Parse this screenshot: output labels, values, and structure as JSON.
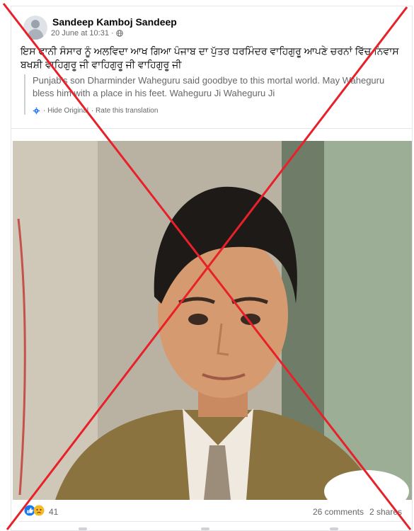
{
  "post": {
    "author": "Sandeep Kamboj Sandeep",
    "timestamp": "20 June at 10:31 ·",
    "privacy_icon": "globe-icon",
    "text": "ਇਸ ਫਾਨੀ ਸੰਸਾਰ ਨੂੰ ਅਲਵਿਦਾ ਆਖ ਗਿਆ ਪੰਜਾਬ ਦਾ ਪੁੱਤਰ ਧਰਮਿੰਦਰ ਵਾਹਿਗੁਰੂ ਆਪਣੇ ਚਰਨਾਂ ਵਿੱਚ ਨਿਵਾਸ ਬਖਸ਼ੀ ਵਾਹਿਗੁਰੂ ਜੀ ਵਾਹਿਗੁਰੂ ਜੀ ਵਾਹਿਗੁਰੂ ਜੀ",
    "translation": "Punjab's son Dharminder Waheguru said goodbye to this mortal world. May Waheguru bless him with a place in his feet. Waheguru Ji Waheguru Ji",
    "hide_original": "· Hide Original",
    "rate_translation": "· Rate this translation"
  },
  "engagement": {
    "reaction_count": "41",
    "comments": "26 comments",
    "shares": "2 shares"
  },
  "colors": {
    "cross": "#e8202a",
    "like_blue": "#1877f2",
    "sad_yellow": "#f7b928"
  }
}
